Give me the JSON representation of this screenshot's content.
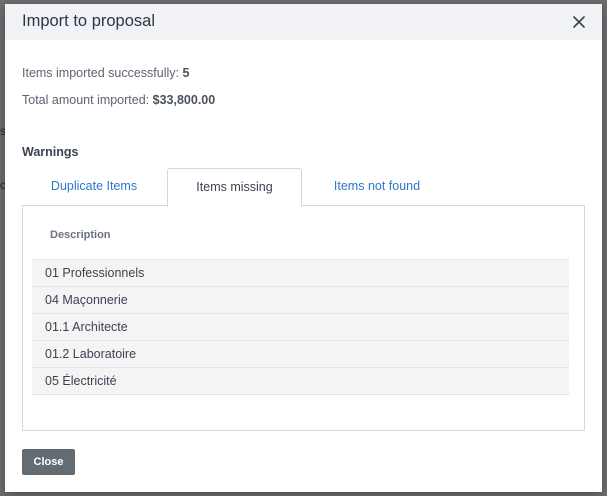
{
  "modal": {
    "title": "Import to proposal",
    "summary": {
      "items_label": "Items imported successfully:",
      "items_value": "5",
      "total_label": "Total amount imported:",
      "total_value": "$33,800.00"
    },
    "warnings_title": "Warnings",
    "tabs": [
      {
        "label": "Duplicate Items",
        "active": false
      },
      {
        "label": "Items missing",
        "active": true
      },
      {
        "label": "Items not found",
        "active": false
      }
    ],
    "table": {
      "column_header": "Description",
      "rows": [
        "01 Professionnels",
        "04 Maçonnerie",
        "01.1 Architecte",
        "01.2 Laboratoire",
        "05 Électricité"
      ]
    },
    "close_button_label": "Close"
  },
  "icons": {
    "close": "close-icon"
  },
  "colors": {
    "link": "#2f78c9",
    "header_bg": "#f1f2f6",
    "button_bg": "#636c73",
    "overlay": "#6f6f6f"
  }
}
